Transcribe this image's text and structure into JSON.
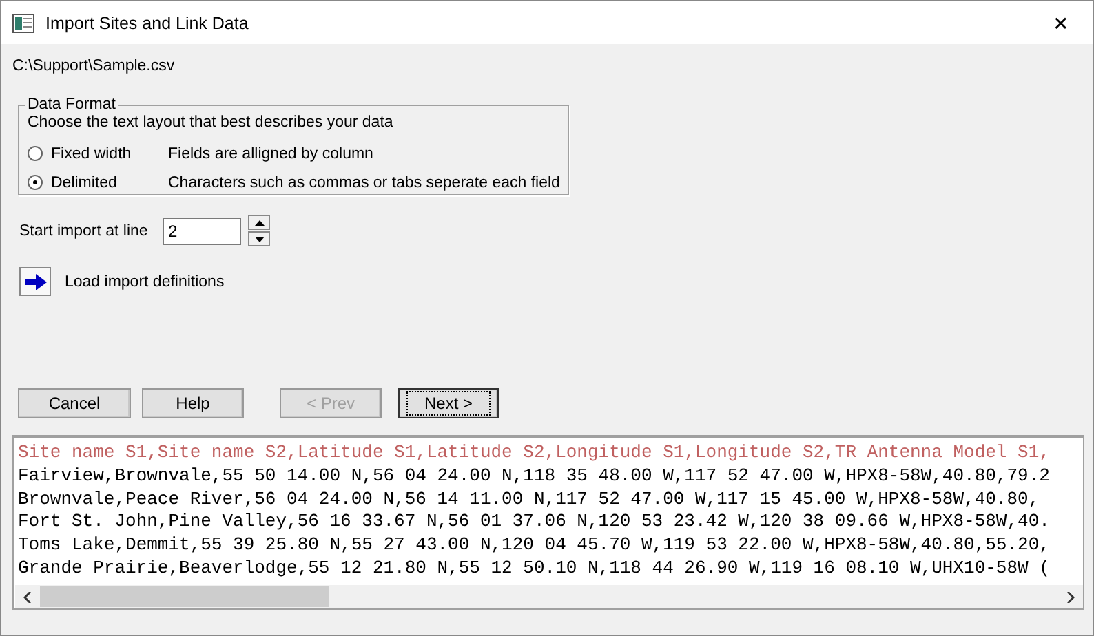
{
  "window": {
    "title": "Import Sites and Link Data",
    "close": "✕"
  },
  "file_path": "C:\\Support\\Sample.csv",
  "data_format": {
    "title": "Data Format",
    "prompt": "Choose the text layout that best describes your data",
    "options": [
      {
        "label": "Fixed width",
        "description": "Fields are alligned by column",
        "selected": false
      },
      {
        "label": "Delimited",
        "description": "Characters such as commas or tabs seperate each field",
        "selected": true
      }
    ]
  },
  "start_line": {
    "label": "Start import at line",
    "value": "2"
  },
  "load_definitions": {
    "label": "Load import definitions"
  },
  "buttons": [
    {
      "label": "Cancel",
      "disabled": false,
      "focused": false
    },
    {
      "label": "Help",
      "disabled": false,
      "focused": false
    },
    {
      "label": "< Prev",
      "disabled": true,
      "focused": false
    },
    {
      "label": "Next >",
      "disabled": false,
      "focused": true
    }
  ],
  "preview": {
    "lines": [
      {
        "text": "Site name S1,Site name S2,Latitude S1,Latitude S2,Longitude S1,Longitude S2,TR Antenna Model S1,",
        "kind": "header"
      },
      {
        "text": "Fairview,Brownvale,55 50 14.00 N,56 04 24.00 N,118 35 48.00 W,117 52 47.00 W,HPX8-58W,40.80,79.2",
        "kind": "data"
      },
      {
        "text": "Brownvale,Peace River,56 04 24.00 N,56 14 11.00 N,117 52 47.00 W,117 15 45.00 W,HPX8-58W,40.80,",
        "kind": "data"
      },
      {
        "text": "Fort St. John,Pine Valley,56 16 33.67 N,56 01 37.06 N,120 53 23.42 W,120 38 09.66 W,HPX8-58W,40.",
        "kind": "data"
      },
      {
        "text": "Toms Lake,Demmit,55 39 25.80 N,55 27 43.00 N,120 04 45.70 W,119 53 22.00 W,HPX8-58W,40.80,55.20,",
        "kind": "data"
      },
      {
        "text": "Grande Prairie,Beaverlodge,55 12 21.80 N,55 12 50.10 N,118 44 26.90 W,119 16 08.10 W,UHX10-58W (",
        "kind": "data"
      }
    ]
  }
}
